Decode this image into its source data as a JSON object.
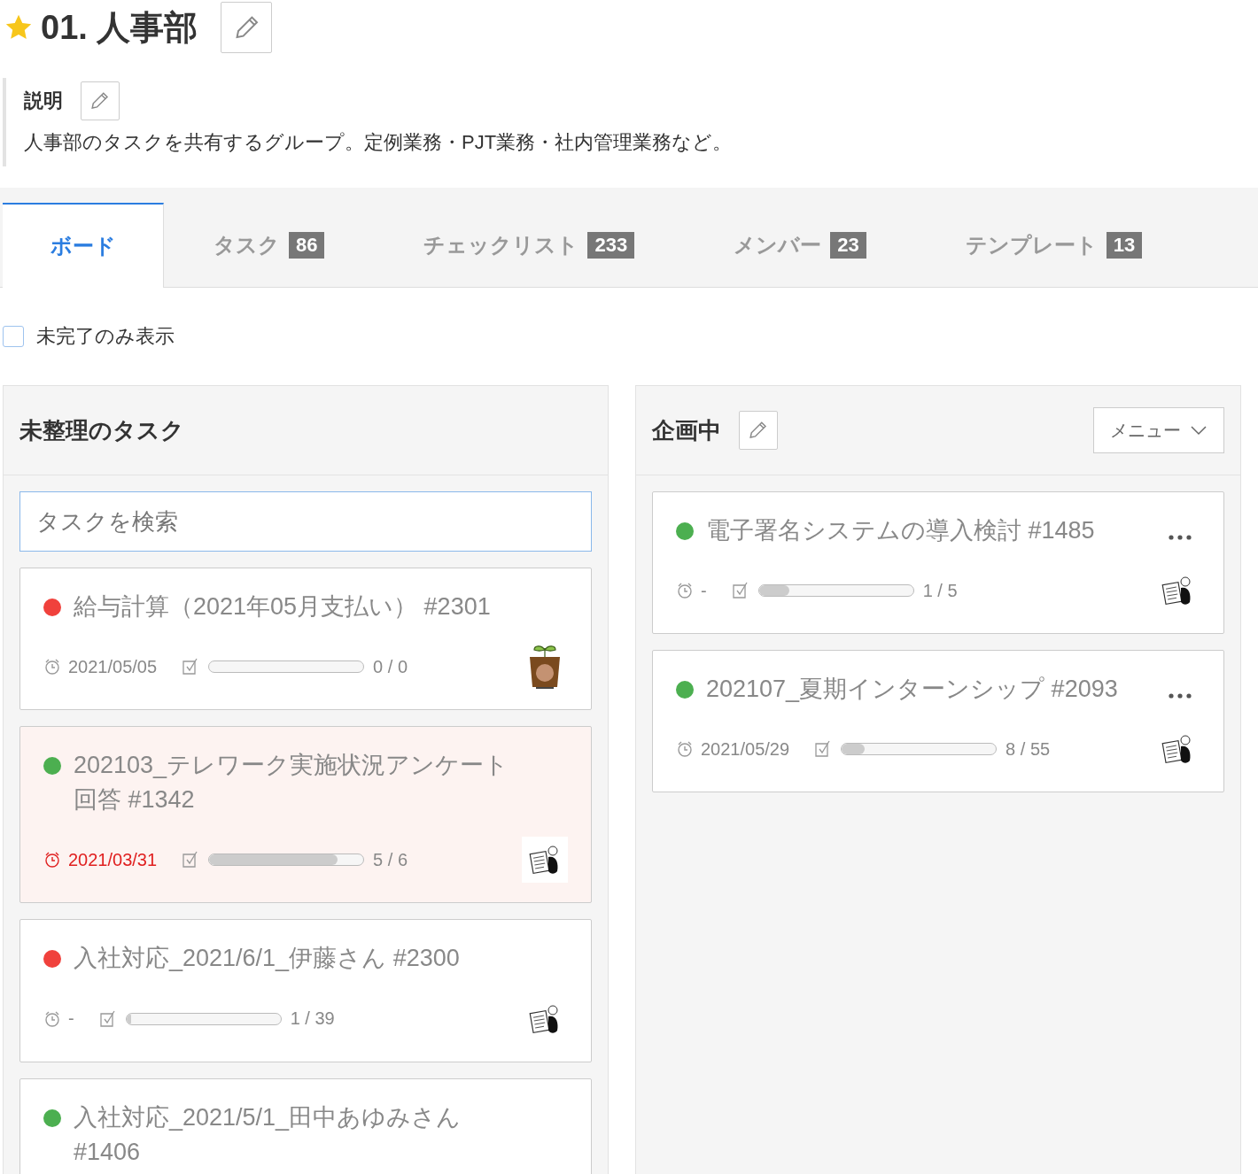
{
  "header": {
    "starred": true,
    "title": "01. 人事部"
  },
  "description": {
    "label": "説明",
    "text": "人事部のタスクを共有するグループ。定例業務・PJT業務・社内管理業務など。"
  },
  "tabs": [
    {
      "label": "ボード",
      "selected": true
    },
    {
      "label": "タスク",
      "count": "86",
      "selected": false
    },
    {
      "label": "チェックリスト",
      "count": "233",
      "selected": false
    },
    {
      "label": "メンバー",
      "count": "23",
      "selected": false
    },
    {
      "label": "テンプレート",
      "count": "13",
      "selected": false
    }
  ],
  "filter": {
    "label": "未完了のみ表示",
    "checked": false
  },
  "columns": [
    {
      "title": "未整理のタスク",
      "editable": false,
      "search": {
        "placeholder": "タスクを検索"
      },
      "cards": [
        {
          "title": "給与計算（2021年05月支払い）  #2301",
          "color": "#f0413c",
          "due": "2021/05/05",
          "overdue": false,
          "level": 0,
          "progress": "0 / 0",
          "kind": "plant",
          "menu": false
        },
        {
          "title": "202103_テレワーク実施状況アンケート回答 #1342",
          "color": "#4caf50",
          "due": "2021/03/31",
          "overdue": true,
          "level": 0.83,
          "progress": "5 / 6",
          "kind": "reader",
          "menu": false
        },
        {
          "title": "入社対応_2021/6/1_伊藤さん #2300",
          "color": "#f0413c",
          "due": "-",
          "overdue": false,
          "level": 0.03,
          "progress": "1 / 39",
          "kind": "reader",
          "menu": false
        },
        {
          "title": "入社対応_2021/5/1_田中あゆみさん #1406",
          "color": "#4caf50",
          "menu": false
        }
      ]
    },
    {
      "title": "企画中",
      "editable": true,
      "menu_button": "メニュー",
      "cards": [
        {
          "title": "電子署名システムの導入検討 #1485",
          "color": "#4caf50",
          "due": "-",
          "overdue": false,
          "level": 0.2,
          "progress": "1 / 5",
          "kind": "reader",
          "menu": true
        },
        {
          "title": "202107_夏期インターンシップ #2093",
          "color": "#4caf50",
          "due": "2021/05/29",
          "overdue": false,
          "level": 0.15,
          "progress": "8 / 55",
          "kind": "reader",
          "menu": true
        }
      ]
    }
  ]
}
